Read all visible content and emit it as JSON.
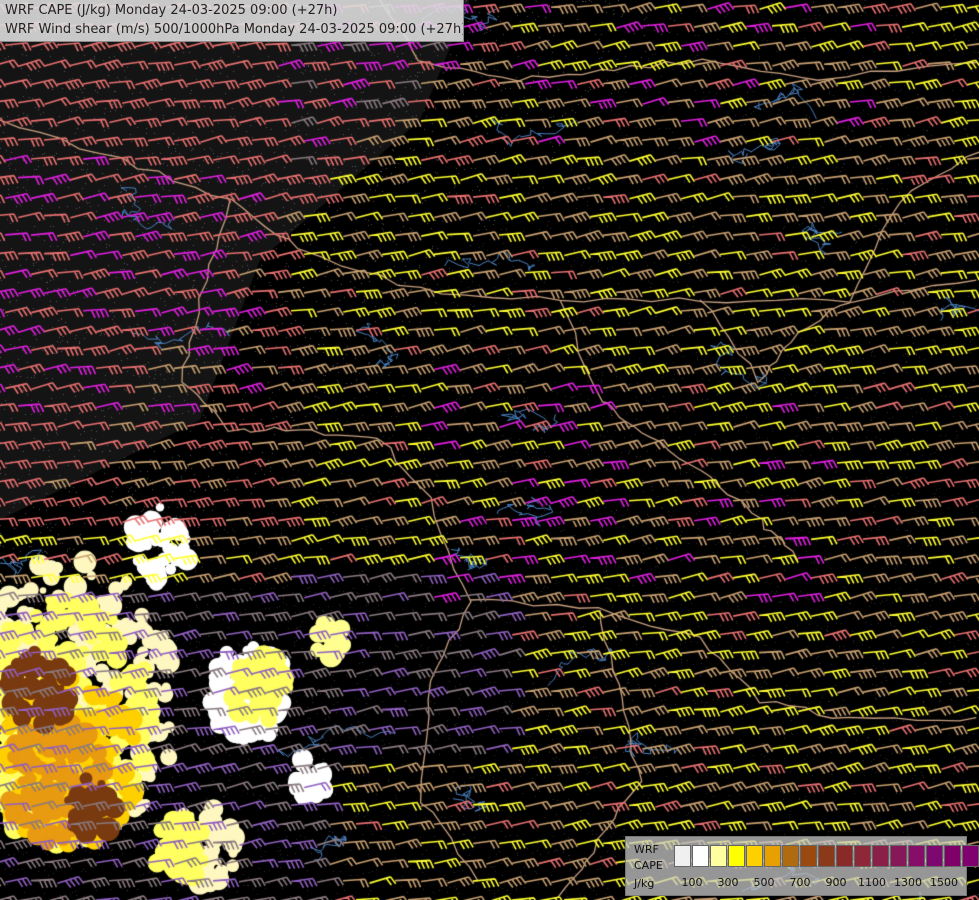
{
  "header": {
    "line1": "WRF CAPE (J/kg) Monday 24-03-2025 09:00 (+27h)",
    "line2": "WRF Wind shear (m/s) 500/1000hPa Monday 24-03-2025 09:00 (+27h)"
  },
  "legend": {
    "model": "WRF",
    "variable": "CAPE",
    "unit": "J/kg",
    "swatch_colors": [
      "#f0f0f0",
      "#ffffff",
      "#ffffa0",
      "#ffff00",
      "#ffd000",
      "#e8a000",
      "#b06a10",
      "#9a4a10",
      "#8a3a18",
      "#8a2a28",
      "#8e2838",
      "#8a2048",
      "#86185a",
      "#860e68",
      "#7c0870",
      "#80006a",
      "#800070"
    ],
    "tick_labels": [
      "100",
      "300",
      "500",
      "700",
      "900",
      "1100",
      "1300",
      "1500"
    ]
  },
  "colors": {
    "barb_magenta": "#e020e0",
    "barb_salmon": "#e87070",
    "barb_yellow": "#ffff30",
    "barb_tan": "#c8a070",
    "barb_purple": "#9060c0",
    "barb_gray": "#8a7a80",
    "border": "#c8a080",
    "river": "#4a80c0",
    "cape_yellow": "#ffff60",
    "cape_orange": "#e89a10",
    "cape_brown": "#7a3a10"
  }
}
